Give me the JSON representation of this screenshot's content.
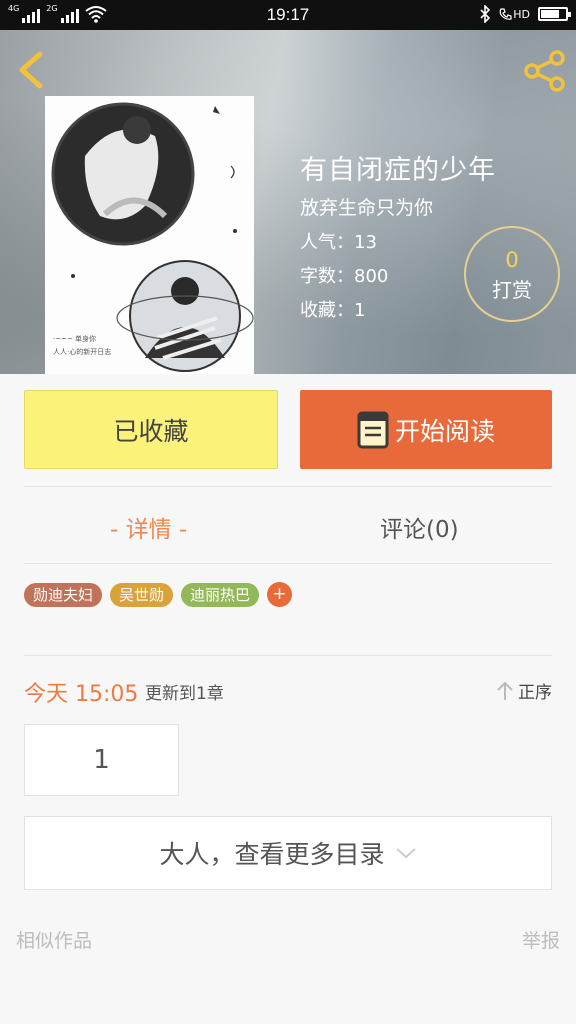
{
  "status_bar": {
    "time": "19:17",
    "network_1": "4G",
    "network_2": "2G",
    "volte": "HD",
    "battery_level": 0.75
  },
  "header": {
    "back_icon": "chevron-left-icon",
    "share_icon": "share-icon"
  },
  "book": {
    "title": "有自闭症的少年",
    "subtitle": "放弃生命只为你",
    "popularity": "人气：13",
    "word_count": "字数：800",
    "favorites": "收藏：1",
    "tip_count": "0",
    "tip_label": "打赏"
  },
  "actions": {
    "collected_label": "已收藏",
    "start_reading_label": "开始阅读"
  },
  "tabs": {
    "detail": "- 详情 -",
    "comments": "评论(0)"
  },
  "tags": [
    {
      "label": "勋迪夫妇",
      "color": "#c0725a"
    },
    {
      "label": "吴世勋",
      "color": "#d9a23a"
    },
    {
      "label": "迪丽热巴",
      "color": "#93b85a"
    }
  ],
  "tag_add": "+",
  "update": {
    "time": "今天 15:05",
    "text": "更新到1章",
    "order_label": "正序"
  },
  "chapters": {
    "first": "1",
    "more_label": "大人，查看更多目录"
  },
  "footer": {
    "similar": "相似作品",
    "report": "举报"
  },
  "colors": {
    "accent": "#e8693a",
    "collect_bg": "#fbf27a",
    "tip_number": "#f7d45a"
  }
}
